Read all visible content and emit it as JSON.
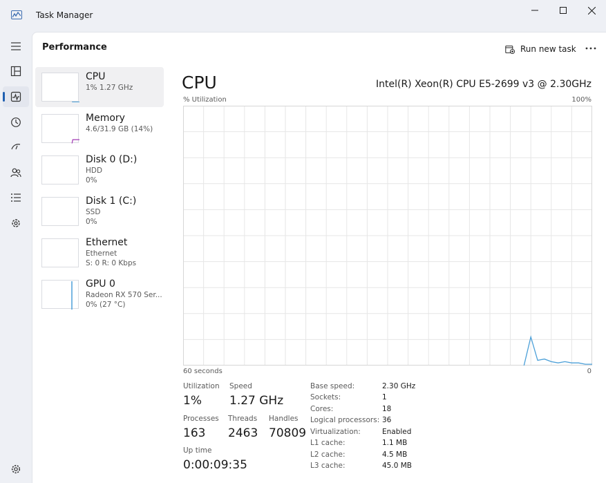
{
  "window": {
    "title": "Task Manager"
  },
  "header": {
    "title": "Performance",
    "run_task_label": "Run new task"
  },
  "sidebar_devices": [
    {
      "name": "CPU",
      "line1": "1% 1.27 GHz",
      "line2": ""
    },
    {
      "name": "Memory",
      "line1": "4.6/31.9 GB (14%)",
      "line2": ""
    },
    {
      "name": "Disk 0 (D:)",
      "line1": "HDD",
      "line2": "0%"
    },
    {
      "name": "Disk 1 (C:)",
      "line1": "SSD",
      "line2": "0%"
    },
    {
      "name": "Ethernet",
      "line1": "Ethernet",
      "line2": "S: 0 R: 0 Kbps"
    },
    {
      "name": "GPU 0",
      "line1": "Radeon RX 570 Ser...",
      "line2": "0% (27 °C)"
    }
  ],
  "main": {
    "title": "CPU",
    "cpu_model": "Intel(R) Xeon(R) CPU E5-2699 v3 @ 2.30GHz",
    "graph_label": "% Utilization",
    "graph_max": "100%",
    "graph_time": "60 seconds",
    "graph_min": "0"
  },
  "chart_data": {
    "type": "line",
    "x": [
      60,
      59,
      58,
      57,
      56,
      55,
      54,
      53,
      52,
      51,
      50,
      49,
      48,
      47,
      46,
      45,
      44,
      43,
      42,
      41,
      40,
      39,
      38,
      37,
      36,
      35,
      34,
      33,
      32,
      31,
      30,
      29,
      28,
      27,
      26,
      25,
      24,
      23,
      22,
      21,
      20,
      19,
      18,
      17,
      16,
      15,
      14,
      13,
      12,
      11,
      10,
      9,
      8,
      7,
      6,
      5,
      4,
      3,
      2,
      1,
      0
    ],
    "series": [
      {
        "values": [
          null,
          null,
          null,
          null,
          null,
          null,
          null,
          null,
          null,
          null,
          null,
          null,
          null,
          null,
          null,
          null,
          null,
          null,
          null,
          null,
          null,
          null,
          null,
          null,
          null,
          null,
          null,
          null,
          null,
          null,
          null,
          null,
          null,
          null,
          null,
          null,
          null,
          null,
          null,
          null,
          null,
          null,
          null,
          null,
          null,
          null,
          null,
          null,
          null,
          null,
          0,
          11,
          2,
          2.5,
          1.5,
          1,
          1.5,
          1,
          1,
          0.5,
          0.5
        ]
      }
    ],
    "xlabel": "60 seconds",
    "ylabel": "% Utilization",
    "xlim": [
      60,
      0
    ],
    "ylim": [
      0,
      100
    ],
    "grid": true,
    "colors": {
      "line": "#4a9fd8",
      "grid": "#e6e6e6",
      "border": "#d6d6d6"
    }
  },
  "stats": {
    "utilization_label": "Utilization",
    "utilization": "1%",
    "speed_label": "Speed",
    "speed": "1.27 GHz",
    "processes_label": "Processes",
    "processes": "163",
    "threads_label": "Threads",
    "threads": "2463",
    "handles_label": "Handles",
    "handles": "70809",
    "uptime_label": "Up time",
    "uptime": "0:00:09:35"
  },
  "info": [
    {
      "label": "Base speed:",
      "value": "2.30 GHz"
    },
    {
      "label": "Sockets:",
      "value": "1"
    },
    {
      "label": "Cores:",
      "value": "18"
    },
    {
      "label": "Logical processors:",
      "value": "36"
    },
    {
      "label": "Virtualization:",
      "value": "Enabled"
    },
    {
      "label": "L1 cache:",
      "value": "1.1 MB"
    },
    {
      "label": "L2 cache:",
      "value": "4.5 MB"
    },
    {
      "label": "L3 cache:",
      "value": "45.0 MB"
    }
  ],
  "sidebar_thumbs": {
    "cpu_level": 1,
    "memory_level": 14,
    "gpu_level": 0,
    "cpu_color": "#4a9fd8",
    "memory_color": "#a238b4",
    "gpu_color": "#4a9fd8"
  },
  "icons": [
    "hamburger-icon",
    "processes-icon",
    "performance-icon",
    "app-history-icon",
    "startup-icon",
    "users-icon",
    "details-icon",
    "services-icon",
    "settings-icon"
  ]
}
